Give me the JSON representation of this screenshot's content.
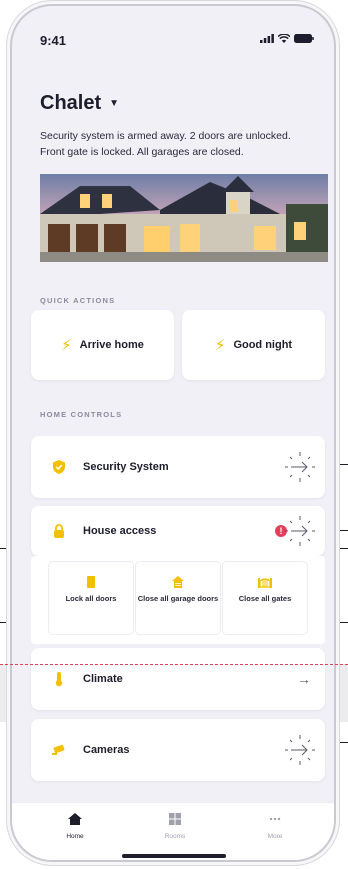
{
  "status_bar": {
    "time": "9:41"
  },
  "header": {
    "title": "Chalet"
  },
  "summary": "Security system is armed away. 2 doors are unlocked. Front gate is locked. All garages are closed.",
  "quick_actions": {
    "label": "QUICK ACTIONS",
    "items": [
      {
        "label": "Arrive home",
        "icon": "bolt-icon"
      },
      {
        "label": "Good night",
        "icon": "bolt-icon"
      }
    ]
  },
  "home_controls": {
    "label": "HOME CONTROLS",
    "items": [
      {
        "label": "Security System",
        "icon": "shield-icon"
      },
      {
        "label": "House access",
        "icon": "lock-icon",
        "alert": "!"
      },
      {
        "label": "Climate",
        "icon": "thermometer-icon"
      },
      {
        "label": "Cameras",
        "icon": "camera-icon"
      }
    ],
    "house_access_actions": [
      {
        "label": "Lock all doors",
        "icon": "door-icon"
      },
      {
        "label": "Close all garage doors",
        "icon": "garage-icon"
      },
      {
        "label": "Close all gates",
        "icon": "gate-icon"
      }
    ]
  },
  "tab_bar": [
    {
      "label": "Home",
      "icon": "home-icon",
      "active": true
    },
    {
      "label": "Rooms",
      "icon": "rooms-icon",
      "active": false
    },
    {
      "label": "More",
      "icon": "more-icon",
      "active": false
    }
  ],
  "colors": {
    "accent": "#f3c000",
    "alert": "#e0415a",
    "background": "#f1f0f7",
    "card": "#ffffff",
    "text": "#1d1d2b"
  }
}
